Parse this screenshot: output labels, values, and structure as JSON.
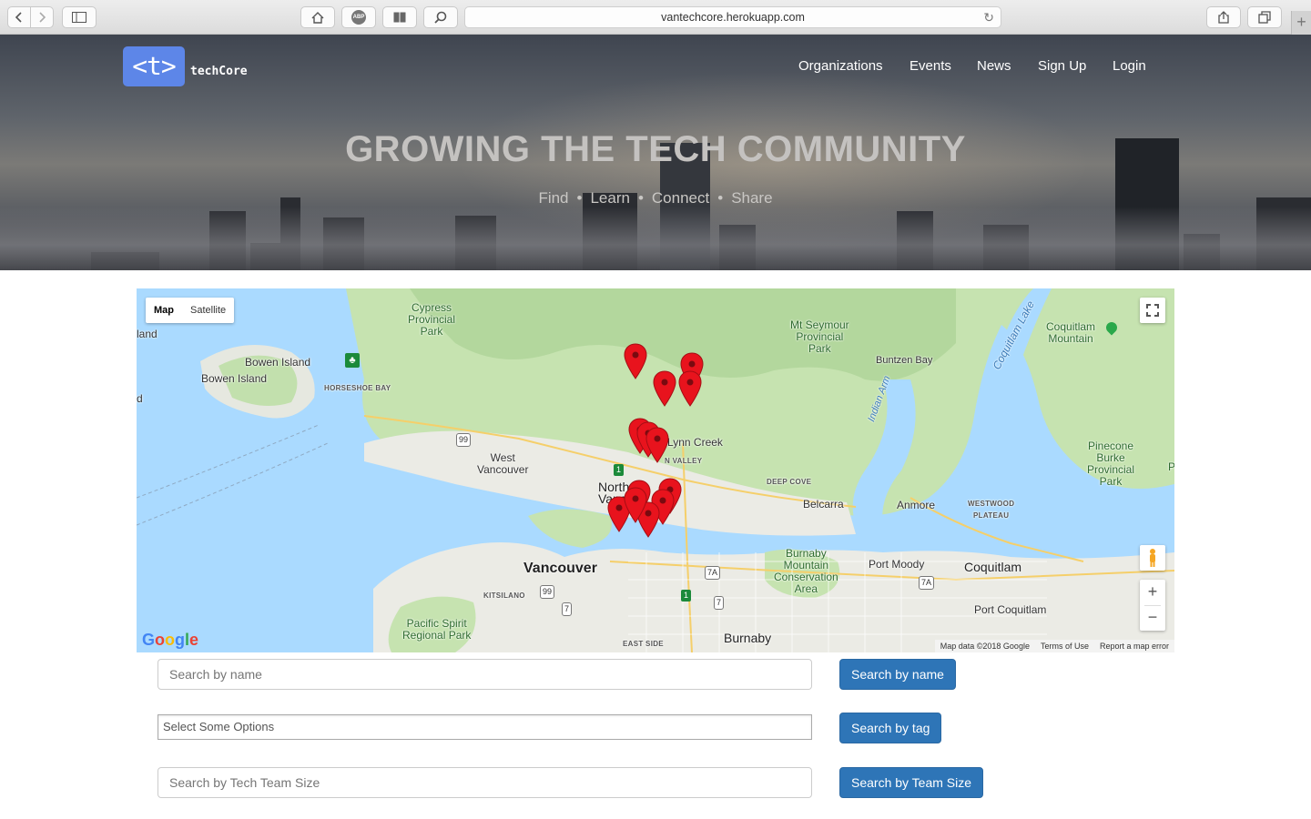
{
  "browser": {
    "url": "vantechcore.herokuapp.com",
    "icons": [
      "back-icon",
      "forward-icon",
      "sidebar-icon",
      "home-icon",
      "adblock-icon",
      "reader-icon",
      "search-icon",
      "reload-icon",
      "share-icon",
      "tabs-icon",
      "new-tab-icon"
    ],
    "adblock_label": "ABP",
    "new_tab_label": "+"
  },
  "header": {
    "logo_mark": "<t>",
    "logo_text": "techCore",
    "nav": [
      "Organizations",
      "Events",
      "News",
      "Sign Up",
      "Login"
    ],
    "title": "GROWING THE TECH COMMUNITY",
    "subtitle": [
      "Find",
      "Learn",
      "Connect",
      "Share"
    ],
    "separator": "•"
  },
  "map": {
    "type_controls": [
      "Map",
      "Satellite"
    ],
    "active_type": "Map",
    "labels": {
      "cypress": "Cypress\nProvincial\nPark",
      "seymour": "Mt Seymour\nProvincial\nPark",
      "coquitlam_mtn": "Coquitlam\nMountain",
      "coquitlam_lake": "Coquitlam Lake",
      "island_edge": "land",
      "bowen": "Bowen Island",
      "bowen2": "Bowen Island",
      "horseshoe": "HORSESHOE BAY",
      "buntzen": "Buntzen Bay",
      "indian_arm": "Indian Arm",
      "lynn": "Lynn Creek",
      "lynn_valley": "N VALLEY",
      "west_van": "West\nVancouver",
      "pinecone": "Pinecone\nBurke\nProvincial\nPark",
      "deep_cove": "DEEP COVE",
      "north_van": "North\nVanc",
      "belcarra": "Belcarra",
      "anmore": "Anmore",
      "westwood": "WESTWOOD\nPLATEAU",
      "vancouver": "Vancouver",
      "burnaby_mtn": "Burnaby\nMountain\nConservation\nArea",
      "port_moody": "Port Moody",
      "coquitlam": "Coquitlam",
      "kitsilano": "KITSILANO",
      "port_coquitlam": "Port Coquitlam",
      "pacific_spirit": "Pacific Spirit\nRegional Park",
      "east_side": "EAST SIDE",
      "burnaby": "Burnaby",
      "edge_d": "d",
      "edge_p": "P"
    },
    "highway_shields": [
      "99",
      "1",
      "7A",
      "99",
      "7",
      "7",
      "7A",
      "1"
    ],
    "markers_count": 13,
    "zoom_in": "+",
    "zoom_out": "−",
    "logo": "Google",
    "attribution": [
      "Map data ©2018 Google",
      "Terms of Use",
      "Report a map error"
    ]
  },
  "search": {
    "name_placeholder": "Search by name",
    "name_button": "Search by name",
    "tag_placeholder": "Select Some Options",
    "tag_button": "Search by tag",
    "size_placeholder": "Search by Tech Team Size",
    "size_button": "Search by Team Size"
  },
  "colors": {
    "accent": "#2e75b7",
    "logo_bg": "#5d86e8",
    "marker": "#e8131d",
    "water": "#aadaff",
    "land": "#e8e8e2",
    "park": "#b9dba4"
  }
}
